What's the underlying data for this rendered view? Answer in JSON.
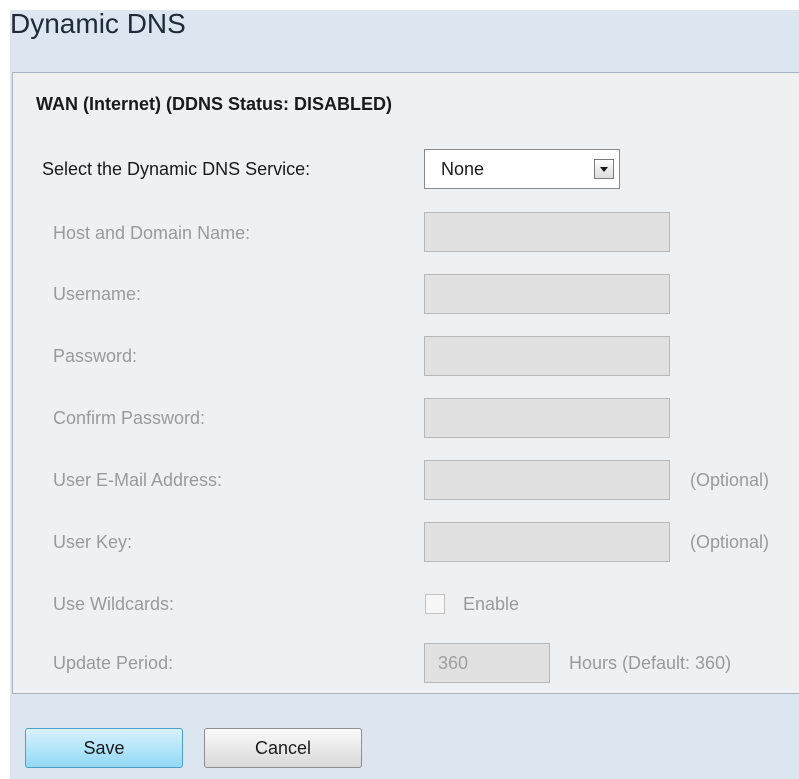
{
  "page": {
    "title": "Dynamic DNS"
  },
  "section": {
    "title": "WAN (Internet) (DDNS Status: DISABLED)"
  },
  "service": {
    "label": "Select the Dynamic DNS Service:",
    "selected": "None"
  },
  "fields": {
    "host": {
      "label": "Host and Domain Name:",
      "value": ""
    },
    "username": {
      "label": "Username:",
      "value": ""
    },
    "password": {
      "label": "Password:",
      "value": ""
    },
    "confirm_password": {
      "label": "Confirm Password:",
      "value": ""
    },
    "email": {
      "label": "User E-Mail Address:",
      "value": "",
      "note": "(Optional)"
    },
    "user_key": {
      "label": "User Key:",
      "value": "",
      "note": "(Optional)"
    }
  },
  "wildcards": {
    "label": "Use Wildcards:",
    "checkbox_label": "Enable",
    "checked": false
  },
  "update_period": {
    "label": "Update Period:",
    "value": "360",
    "unit": "Hours (Default: 360)"
  },
  "actions": {
    "save": "Save",
    "cancel": "Cancel"
  },
  "colors": {
    "page_background": "#dbe6f1",
    "panel_background": "#eef0f2",
    "disabled_text": "#9a9a9a",
    "disabled_field": "#e1e1e1",
    "save_button": "#93d9f6"
  }
}
